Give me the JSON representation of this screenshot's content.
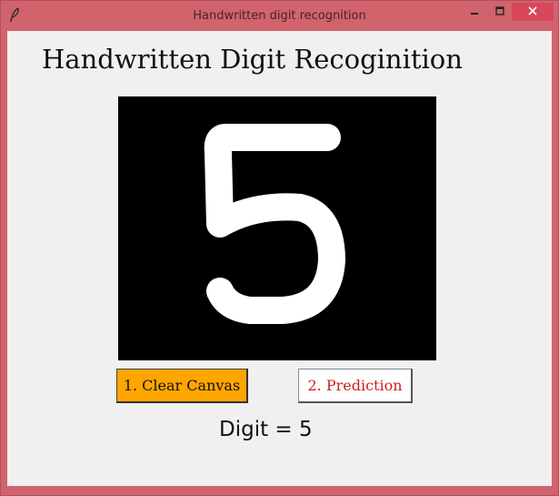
{
  "window": {
    "title": "Handwritten digit recognition",
    "icons": [
      "feather-icon",
      "minimize-icon",
      "maximize-icon",
      "close-icon"
    ],
    "title_bar_color": "#d1636d",
    "close_button_color": "#d9475a"
  },
  "app": {
    "heading": "Handwritten Digit Recoginition",
    "canvas": {
      "background": "#000000",
      "stroke_color": "#ffffff",
      "drawn_digit": "5"
    },
    "buttons": {
      "clear_label": "1. Clear Canvas",
      "clear_color": "#ffa500",
      "predict_label": "2. Prediction",
      "predict_text_color": "#cc1f1f"
    },
    "result_text": "Digit = 5"
  }
}
